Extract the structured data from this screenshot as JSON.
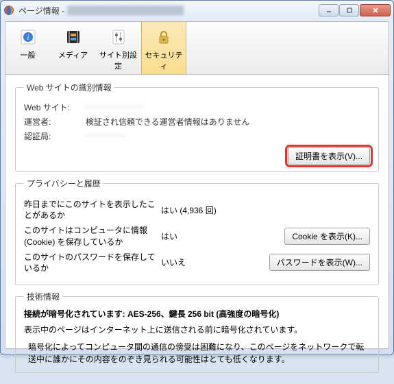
{
  "window": {
    "title": "ページ情報 -"
  },
  "tabs": {
    "general": "一般",
    "media": "メディア",
    "permissions": "サイト別設定",
    "security": "セキュリティ"
  },
  "identity": {
    "legend": "Web サイトの識別情報",
    "website_label": "Web サイト:",
    "website_value": "―――――――",
    "owner_label": "運営者:",
    "owner_value": "検証され信頼できる運営者情報はありません",
    "ca_label": "認証局:",
    "ca_value": "―――――",
    "view_cert": "証明書を表示(V)..."
  },
  "privacy": {
    "legend": "プライバシーと履歴",
    "visited_label": "昨日までにこのサイトを表示したことがあるか",
    "visited_value": "はい (4,936 回)",
    "cookies_label": "このサイトはコンピュータに情報 (Cookie) を保存しているか",
    "cookies_value": "はい",
    "cookies_btn": "Cookie を表示(K)...",
    "passwords_label": "このサイトのパスワードを保存しているか",
    "passwords_value": "いいえ",
    "passwords_btn": "パスワードを表示(W)..."
  },
  "tech": {
    "legend": "技術情報",
    "headline": "接続が暗号化されています: AES-256、鍵長 256 bit (高強度の暗号化)",
    "sub": "表示中のページはインターネット上に送信される前に暗号化されています。",
    "body": "暗号化によってコンピュータ間の通信の傍受は困難になり、このページをネットワークで転送中に誰かにその内容をのぞき見られる可能性はとても低くなります。"
  }
}
